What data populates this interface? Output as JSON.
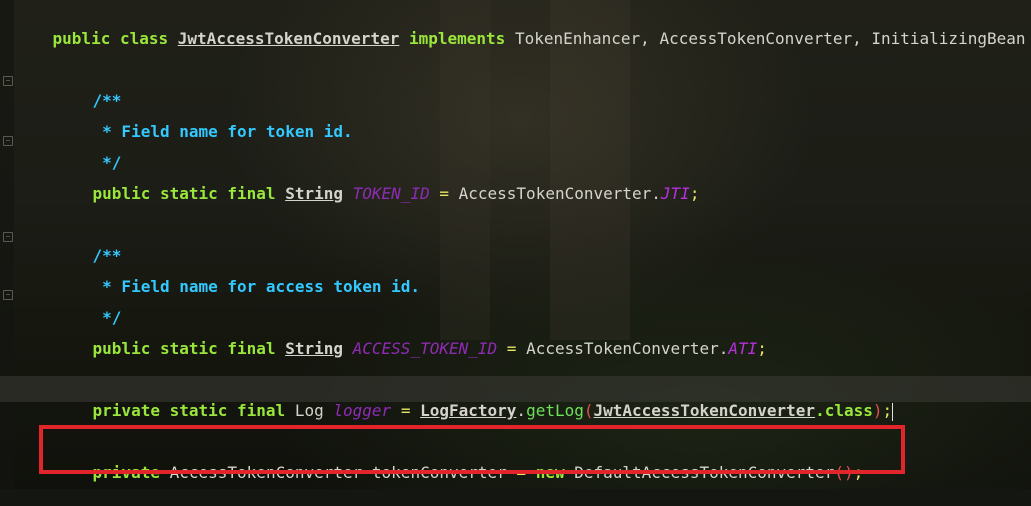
{
  "editor": {
    "lines": {
      "class_decl": {
        "kw_public": "public",
        "kw_class": "class",
        "class_name": "JwtAccessTokenConverter",
        "kw_implements": "implements",
        "interfaces": "TokenEnhancer, AccessTokenConverter, InitializingBean"
      },
      "doc1_open": "/**",
      "doc1_text": " * Field name for token id.",
      "doc1_close": " */",
      "token_id_decl": {
        "modifiers": "public static final",
        "type": "String",
        "name": "TOKEN_ID",
        "eq": "=",
        "owner": "AccessTokenConverter.",
        "value": "JTI",
        "semi": ";"
      },
      "doc2_open": "/**",
      "doc2_text": " * Field name for access token id.",
      "doc2_close": " */",
      "access_token_id_decl": {
        "modifiers": "public static final",
        "type": "String",
        "name": "ACCESS_TOKEN_ID",
        "eq": "=",
        "owner": "AccessTokenConverter.",
        "value": "ATI",
        "semi": ";"
      },
      "logger_decl": {
        "modifiers": "private static final",
        "type": "Log",
        "name": "logger",
        "eq": "=",
        "factory": "LogFactory",
        "dot": ".",
        "method": "getLog",
        "open_paren": "(",
        "arg_class": "JwtAccessTokenConverter",
        "arg_suffix": ".class",
        "close_paren": ")",
        "semi": ";"
      },
      "converter_decl": {
        "modifier": "private",
        "type": "AccessTokenConverter",
        "name": "tokenConverter",
        "eq": "=",
        "kw_new": "new",
        "ctor": "DefaultAccessTokenConverter",
        "parens": "()",
        "semi": ";"
      }
    }
  },
  "colors": {
    "keyword": "#9ae63b",
    "comment": "#33c8ff",
    "constant": "#8f2bb4",
    "highlight_border": "#e2252b"
  }
}
